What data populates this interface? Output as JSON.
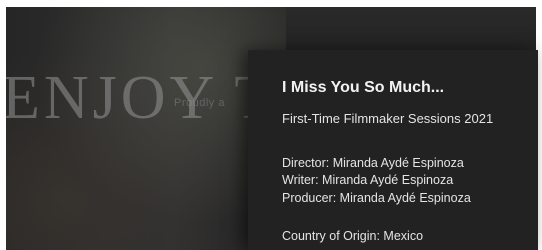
{
  "background": {
    "faint_text": "Proudly a",
    "big_word": "ENJOY T"
  },
  "details": {
    "title": "I Miss You So Much...",
    "program": "First-Time Filmmaker Sessions 2021",
    "director": "Director: Miranda Aydé Espinoza",
    "writer": "Writer: Miranda Aydé Espinoza",
    "producer": "Producer: Miranda Aydé Espinoza",
    "country": "Country of Origin: Mexico"
  },
  "colors": {
    "panel_bg": "#222222",
    "text": "#e4e4e4"
  }
}
